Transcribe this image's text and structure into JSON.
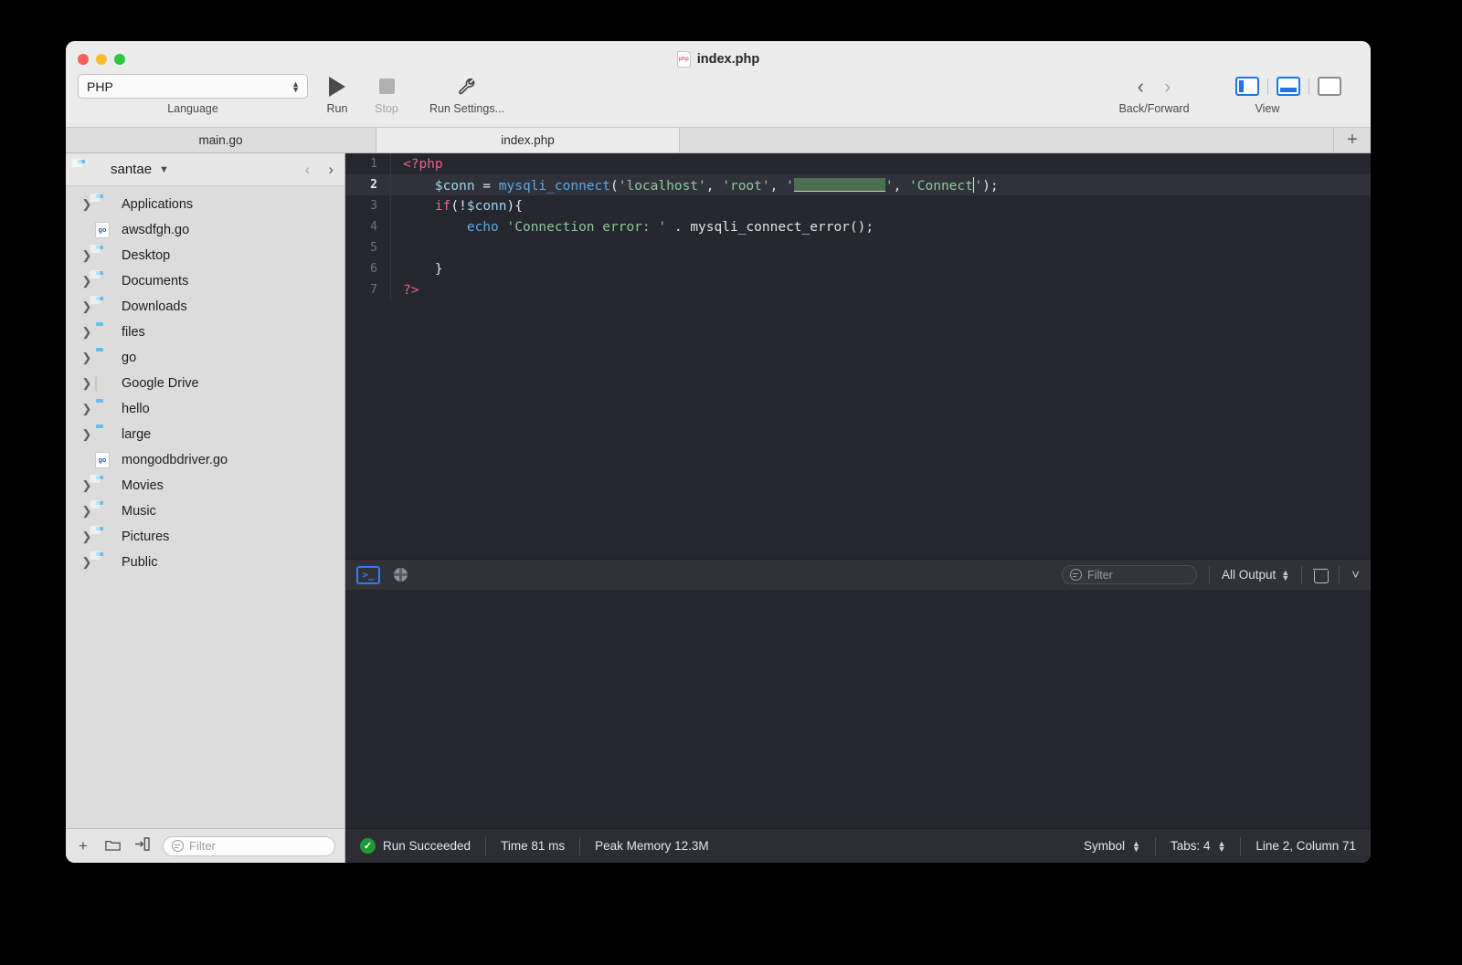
{
  "window": {
    "title": "index.php",
    "title_icon": "php-file-icon",
    "traffic_lights": [
      "close-red",
      "minimize-yellow",
      "maximize-green"
    ]
  },
  "toolbar": {
    "language": {
      "value": "PHP",
      "caption": "Language"
    },
    "run": {
      "caption": "Run",
      "icon": "play-triangle-icon"
    },
    "stop": {
      "caption": "Stop",
      "icon": "stop-square-icon",
      "disabled": true
    },
    "run_settings": {
      "caption": "Run Settings...",
      "icon": "wrench-icon"
    },
    "back_forward": {
      "caption": "Back/Forward",
      "back_icon": "chevron-left-icon",
      "forward_icon": "chevron-right-icon"
    },
    "view": {
      "caption": "View",
      "buttons": [
        {
          "name": "toggle-left-sidebar",
          "active": true
        },
        {
          "name": "toggle-bottom-panel",
          "active": true
        },
        {
          "name": "toggle-right-sidebar",
          "active": false
        }
      ]
    }
  },
  "tabs": {
    "items": [
      {
        "label": "main.go",
        "active": false
      },
      {
        "label": "index.php",
        "active": true
      }
    ],
    "new_tab_label": "+"
  },
  "sidebar": {
    "header": {
      "title": "santae",
      "caret": "⌄",
      "back_icon": "chevron-left-icon",
      "forward_icon": "chevron-right-icon"
    },
    "items": [
      {
        "label": "Applications",
        "type": "folder",
        "variant": "apps",
        "expandable": true
      },
      {
        "label": "awsdfgh.go",
        "type": "gofile",
        "expandable": false
      },
      {
        "label": "Desktop",
        "type": "folder",
        "variant": "desktop",
        "expandable": true
      },
      {
        "label": "Documents",
        "type": "folder",
        "variant": "docs",
        "expandable": true
      },
      {
        "label": "Downloads",
        "type": "folder",
        "variant": "downloads",
        "expandable": true
      },
      {
        "label": "files",
        "type": "folder",
        "variant": "plain",
        "expandable": true
      },
      {
        "label": "go",
        "type": "folder",
        "variant": "plain",
        "expandable": true
      },
      {
        "label": "Google Drive",
        "type": "genericfile",
        "expandable": true
      },
      {
        "label": "hello",
        "type": "folder",
        "variant": "plain",
        "expandable": true
      },
      {
        "label": "large",
        "type": "folder",
        "variant": "plain",
        "expandable": true
      },
      {
        "label": "mongodbdriver.go",
        "type": "gofile",
        "expandable": false
      },
      {
        "label": "Movies",
        "type": "folder",
        "variant": "movies",
        "expandable": true
      },
      {
        "label": "Music",
        "type": "folder",
        "variant": "music",
        "expandable": true
      },
      {
        "label": "Pictures",
        "type": "folder",
        "variant": "pictures",
        "expandable": true
      },
      {
        "label": "Public",
        "type": "folder",
        "variant": "public",
        "expandable": true
      }
    ],
    "footer": {
      "add_label": "+",
      "new_folder_icon": "folder-icon",
      "import_icon": "import-arrow-icon",
      "filter_placeholder": "Filter"
    }
  },
  "editor": {
    "language": "php",
    "current_line": 2,
    "lines": [
      {
        "num": "1",
        "tokens": [
          {
            "t": "<?php",
            "c": "tag"
          }
        ]
      },
      {
        "num": "2",
        "tokens": [
          {
            "t": "    ",
            "c": "plain"
          },
          {
            "t": "$conn",
            "c": "var"
          },
          {
            "t": " = ",
            "c": "op"
          },
          {
            "t": "mysqli_connect",
            "c": "fn"
          },
          {
            "t": "(",
            "c": "plain"
          },
          {
            "t": "'localhost'",
            "c": "str"
          },
          {
            "t": ", ",
            "c": "plain"
          },
          {
            "t": "'root'",
            "c": "str"
          },
          {
            "t": ", ",
            "c": "plain"
          },
          {
            "t": "'",
            "c": "str"
          },
          {
            "t": "",
            "c": "redacted"
          },
          {
            "t": "'",
            "c": "str"
          },
          {
            "t": ", ",
            "c": "plain"
          },
          {
            "t": "'Connect",
            "c": "str"
          },
          {
            "t": "",
            "c": "caret"
          },
          {
            "t": "'",
            "c": "str"
          },
          {
            "t": ");",
            "c": "plain"
          }
        ]
      },
      {
        "num": "3",
        "tokens": [
          {
            "t": "    ",
            "c": "plain"
          },
          {
            "t": "if",
            "c": "kw"
          },
          {
            "t": "(!",
            "c": "plain"
          },
          {
            "t": "$conn",
            "c": "var"
          },
          {
            "t": "){",
            "c": "plain"
          }
        ]
      },
      {
        "num": "4",
        "tokens": [
          {
            "t": "        ",
            "c": "plain"
          },
          {
            "t": "echo",
            "c": "fn"
          },
          {
            "t": " ",
            "c": "plain"
          },
          {
            "t": "'Connection error: '",
            "c": "str"
          },
          {
            "t": " . ",
            "c": "plain"
          },
          {
            "t": "mysqli_connect_error",
            "c": "plain"
          },
          {
            "t": "();",
            "c": "plain"
          }
        ]
      },
      {
        "num": "5",
        "tokens": []
      },
      {
        "num": "6",
        "tokens": [
          {
            "t": "    }",
            "c": "plain"
          }
        ]
      },
      {
        "num": "7",
        "tokens": [
          {
            "t": "?>",
            "c": "tag"
          }
        ]
      }
    ],
    "raw_code": "<?php\n    $conn = mysqli_connect('localhost', 'root', '********', 'Connect');\n    if(!$conn){\n        echo 'Connection error: ' . mysqli_connect_error();\n\n    }\n?>",
    "colors": {
      "background": "#25272e",
      "current_line": "#2f323a",
      "tag": "#f0608d",
      "variable": "#9fd3f0",
      "function": "#5ea9e6",
      "string": "#8fc99a",
      "keyword": "#f0608d",
      "plain": "#e2e4e8",
      "redaction": "#4a7050"
    }
  },
  "console": {
    "terminal_icon": "terminal-icon",
    "browser_icon": "globe-icon",
    "filter_placeholder": "Filter",
    "output_selector": "All Output",
    "clear_icon": "trash-icon",
    "collapse_icon": "chevron-down-icon"
  },
  "statusbar": {
    "run_status": "Run Succeeded",
    "run_status_icon": "check-circle-icon",
    "time": "Time 81 ms",
    "memory": "Peak Memory 12.3M",
    "symbol": "Symbol",
    "tabs": "Tabs: 4",
    "position": "Line 2, Column 71",
    "success_color": "#1f9b36"
  }
}
